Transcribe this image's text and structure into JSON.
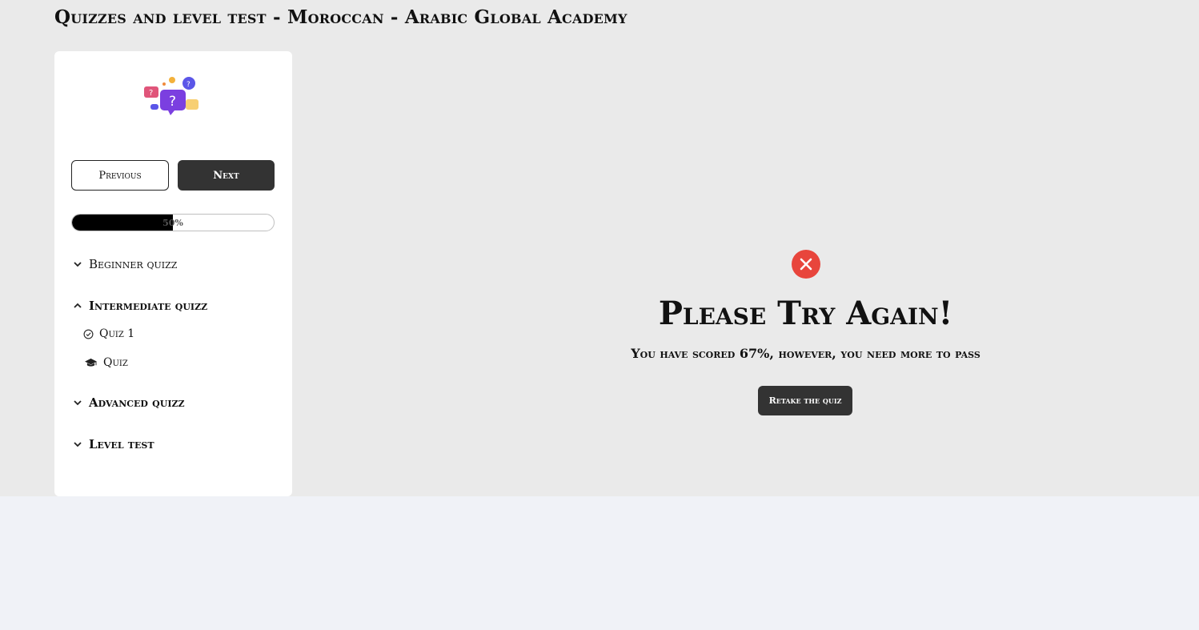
{
  "page": {
    "title": "Quizzes and level test - Moroccan - Arabic Global Academy"
  },
  "sidebar": {
    "logo_icon": "quiz-question-bubbles-icon",
    "previous_label": "Previous",
    "next_label": "Next",
    "progress": {
      "value_percent": 50,
      "label": "50%"
    },
    "sections": [
      {
        "label": "Beginner quizz",
        "expanded": false,
        "chevron_icon": "chevron-down-icon"
      },
      {
        "label": "Intermediate quizz",
        "expanded": true,
        "chevron_icon": "chevron-up-icon",
        "items": [
          {
            "label": "Quiz 1",
            "icon": "check-circle-icon"
          },
          {
            "label": "Quiz",
            "icon": "graduation-cap-icon"
          }
        ]
      },
      {
        "label": "Advanced quizz",
        "expanded": false,
        "chevron_icon": "chevron-down-icon"
      },
      {
        "label": "Level test",
        "expanded": false,
        "chevron_icon": "chevron-down-icon"
      }
    ]
  },
  "result": {
    "status_icon": "close-circle-icon",
    "heading": "Please Try Again!",
    "message": "You have scored 67%, however, you need more to pass",
    "retake_label": "Retake the quiz"
  },
  "colors": {
    "page_background": "#eaeaea",
    "footer_background": "#f0f2f7",
    "button_dark": "#333333",
    "fail_red": "#e8453c",
    "progress_fill": "#000000"
  }
}
